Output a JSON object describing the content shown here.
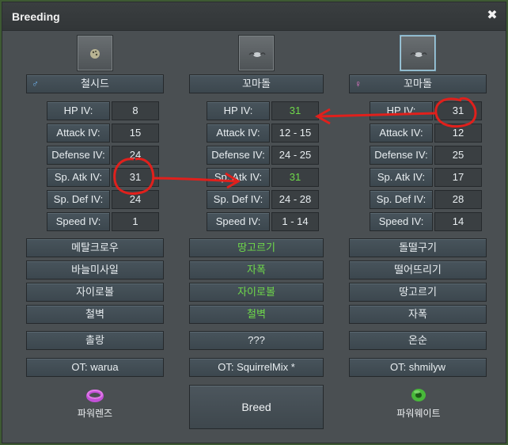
{
  "window": {
    "title": "Breeding"
  },
  "parents": {
    "left": {
      "gender": "♂",
      "name": "철시드",
      "ot": "OT: warua",
      "item_name": "파워렌즈"
    },
    "middle": {
      "name": "꼬마돌",
      "ot": "OT: SquirrelMix *"
    },
    "right": {
      "gender": "♀",
      "name": "꼬마돌",
      "ot": "OT: shmilyw",
      "item_name": "파워웨이트"
    }
  },
  "iv_labels": [
    "HP IV:",
    "Attack IV:",
    "Defense IV:",
    "Sp. Atk IV:",
    "Sp. Def IV:",
    "Speed IV:"
  ],
  "ivs": {
    "left": [
      "8",
      "15",
      "24",
      "31",
      "24",
      "1"
    ],
    "middle": [
      "31",
      "12 - 15",
      "24 - 25",
      "31",
      "24 - 28",
      "1 - 14"
    ],
    "right": [
      "31",
      "12",
      "25",
      "17",
      "28",
      "14"
    ]
  },
  "moves": {
    "left": [
      "메탈크로우",
      "바늘미사일",
      "자이로볼",
      "철벽"
    ],
    "middle": [
      "땅고르기",
      "자폭",
      "자이로볼",
      "철벽"
    ],
    "right": [
      "돌떨구기",
      "떨어뜨리기",
      "땅고르기",
      "자폭"
    ]
  },
  "natures": {
    "left": "촐랑",
    "middle": "???",
    "right": "온순"
  },
  "breed_label": "Breed",
  "colors": {
    "inherited": "#6fd94a",
    "annotation": "#e0201c",
    "male": "#6fb2ee",
    "female": "#f07ad0"
  },
  "icons": {
    "close": "✖"
  }
}
